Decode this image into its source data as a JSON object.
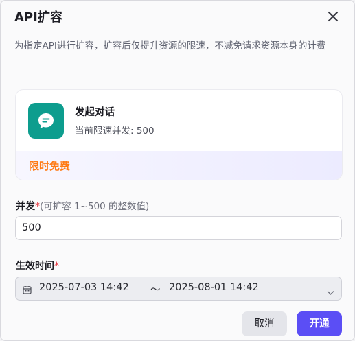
{
  "dialog": {
    "title": "API扩容",
    "description": "为指定API进行扩容，扩容后仅提升资源的限速，不减免请求资源本身的计费"
  },
  "api_card": {
    "name": "发起对话",
    "current_limit": "当前限速并发: 500",
    "badge": "限时免费",
    "icon": "chat-bubble-icon",
    "icon_color": "#0d9d8e"
  },
  "concurrency": {
    "label": "并发",
    "required_mark": "*",
    "hint": "(可扩容 1~500 的整数值)",
    "value": "500"
  },
  "effective_time": {
    "label": "生效时间",
    "required_mark": "*",
    "start": "2025-07-03 14:42",
    "separator": "～",
    "end": "2025-08-01 14:42"
  },
  "buttons": {
    "cancel": "取消",
    "confirm": "开通"
  },
  "colors": {
    "accent": "#5b4ef5",
    "free_badge": "#ff7a14",
    "required": "#e5343d"
  }
}
